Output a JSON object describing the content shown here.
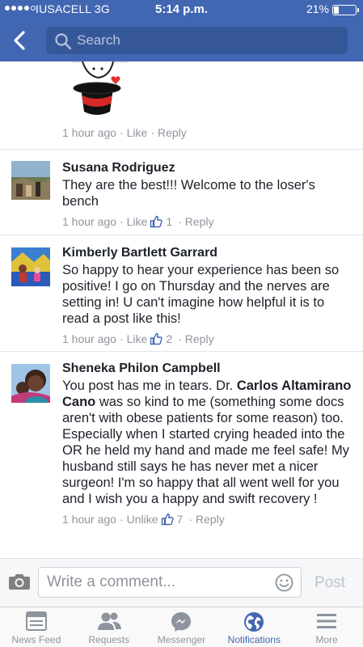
{
  "status_bar": {
    "carrier": "IUSACELL  3G",
    "time": "5:14 p.m.",
    "battery_percent": "21%",
    "battery_level": 0.21
  },
  "nav": {
    "search_placeholder": "Search"
  },
  "colors": {
    "brand_blue": "#4267b2",
    "search_bg": "#365899",
    "meta_gray": "#90949c",
    "like_blue": "#4267b2"
  },
  "comments": [
    {
      "author": "",
      "text": "",
      "time": "1 hour ago",
      "like_label": "Like",
      "reply_label": "Reply",
      "likes": "",
      "sticker": "magician-hat-sticker"
    },
    {
      "author": "Susana Rodriguez",
      "text": "They are the best!!! Welcome to the loser's bench",
      "time": "1 hour ago",
      "like_label": "Like",
      "reply_label": "Reply",
      "likes": "1"
    },
    {
      "author": "Kimberly Bartlett Garrard",
      "text": "So happy to hear your experience has been so positive! I go on Thursday and the nerves are setting in! U can't imagine how helpful it is to read a post like this!",
      "time": "1 hour ago",
      "like_label": "Like",
      "reply_label": "Reply",
      "likes": "2"
    },
    {
      "author": "Sheneka Philon Campbell",
      "text_before": "You post has me in tears. Dr. ",
      "text_tag": "Carlos Altamirano Cano",
      "text_after": " was so kind to me (something some docs aren't with obese patients for some reason) too. Especially when I started crying headed into the OR he held my hand and made me feel safe! My husband still says he has never met a nicer surgeon! I'm so happy that all went well for you and I wish you a happy and swift recovery !",
      "time": "1 hour ago",
      "like_label": "Unlike",
      "reply_label": "Reply",
      "likes": "7"
    }
  ],
  "composer": {
    "placeholder": "Write a comment...",
    "post_label": "Post"
  },
  "tabs": [
    {
      "label": "News Feed",
      "icon": "news-feed-icon",
      "active": false
    },
    {
      "label": "Requests",
      "icon": "friend-requests-icon",
      "active": false
    },
    {
      "label": "Messenger",
      "icon": "messenger-icon",
      "active": false
    },
    {
      "label": "Notifications",
      "icon": "globe-icon",
      "active": true
    },
    {
      "label": "More",
      "icon": "menu-icon",
      "active": false
    }
  ]
}
